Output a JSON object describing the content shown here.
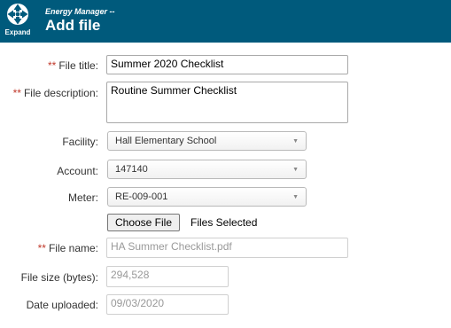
{
  "header": {
    "expand_label": "Expand",
    "subtitle": "Energy Manager --",
    "title": "Add file",
    "bg_color": "#005a7c"
  },
  "form": {
    "required_marker": "**",
    "file_title": {
      "label": "File title:",
      "value": "Summer 2020 Checklist"
    },
    "file_description": {
      "label": "File description:",
      "value": "Routine Summer Checklist"
    },
    "facility": {
      "label": "Facility:",
      "value": "Hall Elementary School"
    },
    "account": {
      "label": "Account:",
      "value": "147140"
    },
    "meter": {
      "label": "Meter:",
      "value": "RE-009-001"
    },
    "file_picker": {
      "button_label": "Choose File",
      "status": "Files Selected"
    },
    "file_name": {
      "label": "File name:",
      "value": "HA Summer Checklist.pdf"
    },
    "file_size": {
      "label": "File size (bytes):",
      "value": "294,528"
    },
    "date_uploaded": {
      "label": "Date uploaded:",
      "value": "09/03/2020"
    }
  },
  "icons": {
    "expand": "expand-icon",
    "dropdown": "chevron-down-icon"
  },
  "colors": {
    "required": "#c0392b",
    "readonly_text": "#999999"
  }
}
